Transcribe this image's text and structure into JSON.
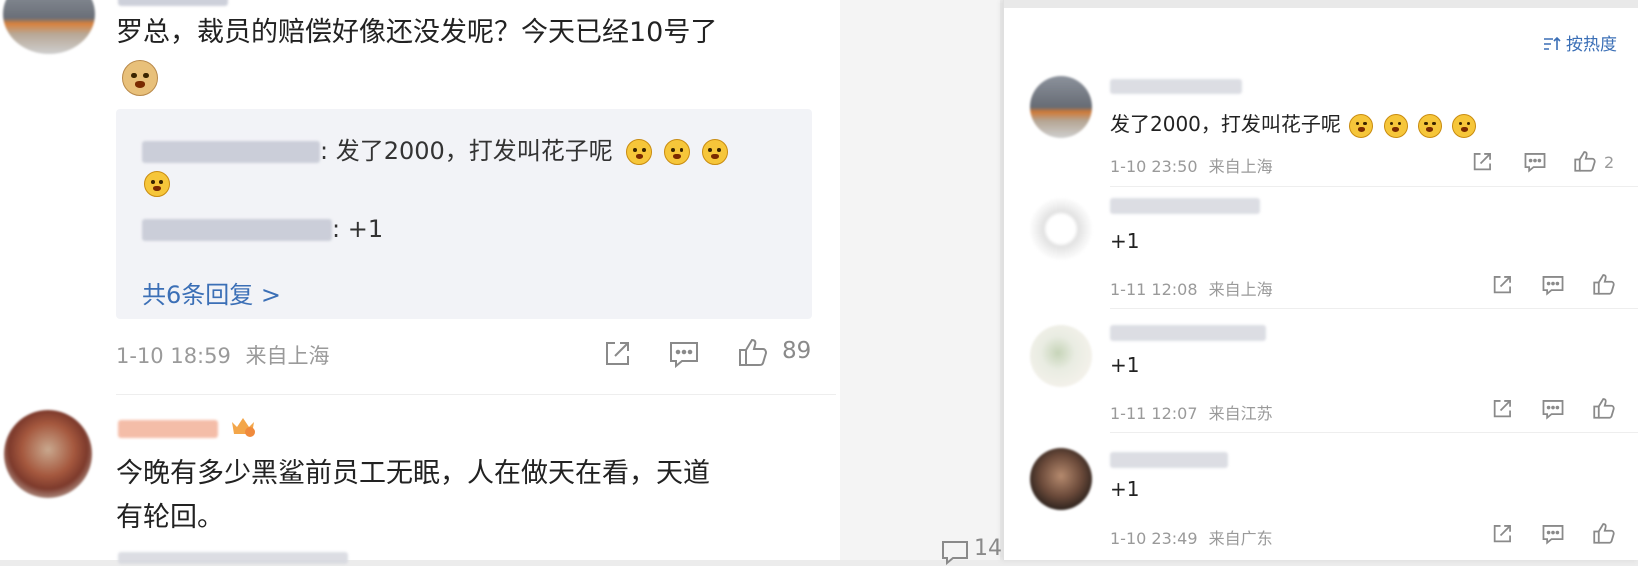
{
  "left_comments": [
    {
      "text": "罗总，裁员的赔偿好像还没发呢？今天已经10号了",
      "replies": [
        {
          "text": ": 发了2000，打发叫花子呢"
        },
        {
          "text": ": +1"
        }
      ],
      "more_replies": "共6条回复 >",
      "time": "1-10 18:59",
      "location": "来自上海",
      "likes": "89"
    },
    {
      "text_line1": "今晚有多少黑鲨前员工无眠，人在做天在看，天道",
      "text_line2": "有轮回。"
    }
  ],
  "middle": {
    "comment_count": "14"
  },
  "right_panel": {
    "sort_label": "按热度",
    "comments": [
      {
        "text": "发了2000，打发叫花子呢",
        "time": "1-10 23:50",
        "location": "来自上海",
        "likes": "2"
      },
      {
        "text": "+1",
        "time": "1-11 12:08",
        "location": "来自上海",
        "likes": ""
      },
      {
        "text": "+1",
        "time": "1-11 12:07",
        "location": "来自江苏",
        "likes": ""
      },
      {
        "text": "+1",
        "time": "1-10 23:49",
        "location": "来自广东",
        "likes": ""
      }
    ]
  },
  "icons": {
    "share": "share-icon",
    "comment": "comment-icon",
    "like": "thumbs-up-icon",
    "sort": "sort-icon",
    "emoji": "angry-face-emoji"
  }
}
